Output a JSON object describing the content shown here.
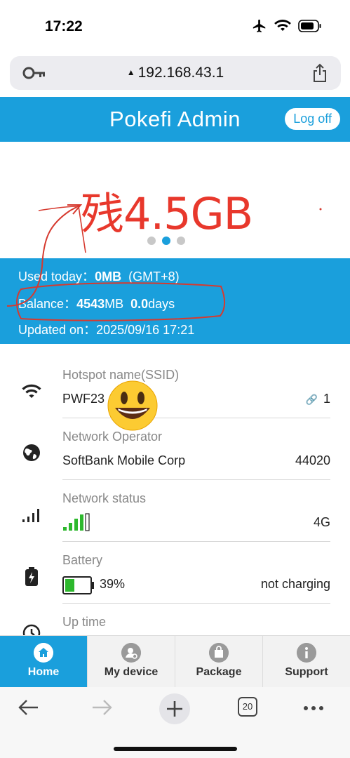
{
  "status_bar": {
    "time": "17:22"
  },
  "address_bar": {
    "url": "192.168.43.1"
  },
  "header": {
    "title": "Pokefi Admin",
    "logoff_label": "Log off"
  },
  "hero": {
    "annotation_text": "残4.5GB",
    "carousel_pages": 3,
    "carousel_active": 2
  },
  "usage": {
    "used_today_label": "Used today：",
    "used_today_value": "0MB",
    "used_today_tz": "(GMT+8)",
    "balance_label": "Balance：",
    "balance_mb": "4543",
    "balance_mb_unit": "MB",
    "balance_days": "0.0",
    "balance_days_unit": "days",
    "updated_label": "Updated on：",
    "updated_value": "2025/09/16 17:21"
  },
  "rows": [
    {
      "label": "Hotspot name(SSID)",
      "value": "PWF23",
      "right": "1",
      "icon": "wifi-icon"
    },
    {
      "label": "Network Operator",
      "value": "SoftBank Mobile Corp",
      "right": "44020",
      "icon": "globe-icon"
    },
    {
      "label": "Network status",
      "value": "",
      "right": "4G",
      "icon": "signal-icon",
      "signal_level": 0.8
    },
    {
      "label": "Battery",
      "value": "39%",
      "right": "not charging",
      "icon": "battery-icon",
      "battery_level": 0.39
    },
    {
      "label": "Up time",
      "value": "",
      "right": "",
      "icon": "clock-icon"
    }
  ],
  "tabs": [
    {
      "label": "Home",
      "icon": "home-icon",
      "active": true
    },
    {
      "label": "My device",
      "icon": "device-icon",
      "active": false
    },
    {
      "label": "Package",
      "icon": "package-icon",
      "active": false
    },
    {
      "label": "Support",
      "icon": "info-icon",
      "active": false
    }
  ],
  "browser": {
    "tab_count": "20"
  },
  "colors": {
    "brand": "#1a9fdc",
    "annotation": "#e8382c",
    "battery_fill": "#2db82d",
    "signal_fill": "#2db82d"
  }
}
